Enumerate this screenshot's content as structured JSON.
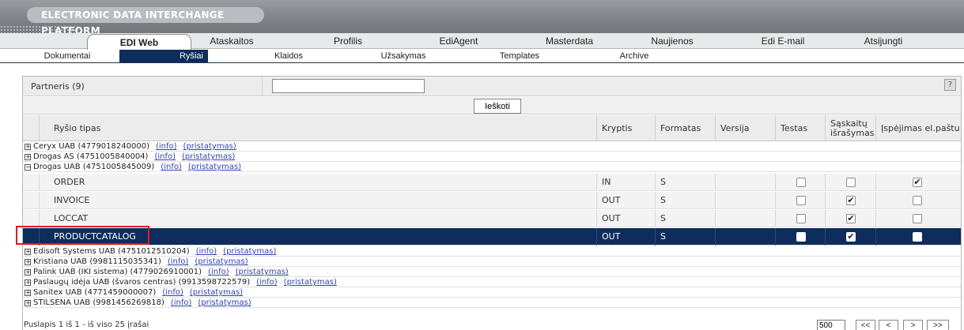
{
  "banner": {
    "title": "ELECTRONIC DATA INTERCHANGE PLATFORM"
  },
  "main_tabs": [
    "EDI Web",
    "Ataskaitos",
    "Profilis",
    "EdiAgent",
    "Masterdata",
    "Naujienos",
    "Edi E-mail",
    "Atsijungti"
  ],
  "sub_tabs": [
    "Dokumentai",
    "Ryšiai",
    "Klaidos",
    "Užsakymas",
    "Templates",
    "Archive"
  ],
  "filter": {
    "label": "Partneris (9)",
    "value": "",
    "help": "?"
  },
  "search_button": "Ieškoti",
  "columns": [
    "Ryšio tipas",
    "Kryptis",
    "Formatas",
    "Versija",
    "Testas",
    "Sąskaitų išrašymas",
    "Įspėjimas el.paštu"
  ],
  "links": {
    "info": "(info)",
    "presentation": "(pristatymas)"
  },
  "groups_before": [
    "Ceryx UAB (4779018240000)",
    "Drogas AS (4751005840004)",
    "Drogas UAB (4751005845009)"
  ],
  "sub_rows": [
    {
      "type": "ORDER",
      "direction": "IN",
      "format": "S",
      "version": "",
      "test": false,
      "invoice": false,
      "email": true
    },
    {
      "type": "INVOICE",
      "direction": "OUT",
      "format": "S",
      "version": "",
      "test": false,
      "invoice": true,
      "email": false
    },
    {
      "type": "LOCCAT",
      "direction": "OUT",
      "format": "S",
      "version": "",
      "test": false,
      "invoice": true,
      "email": false
    },
    {
      "type": "PRODUCTCATALOG",
      "direction": "OUT",
      "format": "S",
      "version": "",
      "test": false,
      "invoice": true,
      "email": false,
      "selected": true
    }
  ],
  "groups_after": [
    "Edisoft Systems UAB (4751012510204)",
    "Kristiana UAB (9981115035341)",
    "Palink UAB (IKI sistema) (4779026910001)",
    "Paslaugų idėja UAB (švaros centras) (9913598722579)",
    "Sanitex UAB (4771459000007)",
    "STILSENA UAB (9981456269818)"
  ],
  "footer": {
    "text": "Puslapis 1 iš 1 - iš viso 25 įrašai",
    "page_size": "500",
    "buttons": [
      "<<",
      "<",
      ">",
      ">>"
    ]
  },
  "colors": {
    "selected_row": "#0e2c5c",
    "highlight": "#e11a26",
    "link": "#3344aa"
  }
}
